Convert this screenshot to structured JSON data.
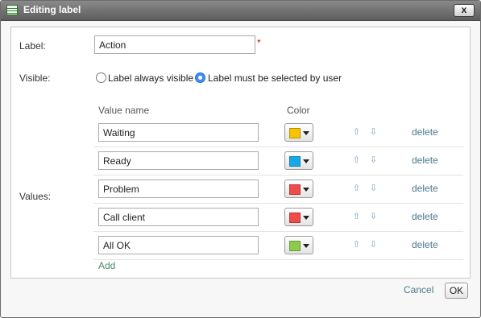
{
  "dialog": {
    "title": "Editing label",
    "close_label": "x"
  },
  "form": {
    "label_caption": "Label:",
    "label_value": "Action",
    "required_mark": "*",
    "visible_caption": "Visible:",
    "visible_options": [
      {
        "label": "Label always visible",
        "selected": false
      },
      {
        "label": "Label must be selected by user",
        "selected": true
      }
    ],
    "values_caption": "Values:",
    "column_headers": {
      "value_name": "Value name",
      "color": "Color"
    },
    "values": [
      {
        "name": "Waiting",
        "color": "#f6c400",
        "delete_label": "delete"
      },
      {
        "name": "Ready",
        "color": "#18a8e8",
        "delete_label": "delete"
      },
      {
        "name": "Problem",
        "color": "#f04a4a",
        "delete_label": "delete"
      },
      {
        "name": "Call client",
        "color": "#f04a4a",
        "delete_label": "delete"
      },
      {
        "name": "All OK",
        "color": "#8ccc4a",
        "delete_label": "delete"
      }
    ],
    "add_label": "Add"
  },
  "footer": {
    "cancel_label": "Cancel",
    "ok_label": "OK"
  }
}
